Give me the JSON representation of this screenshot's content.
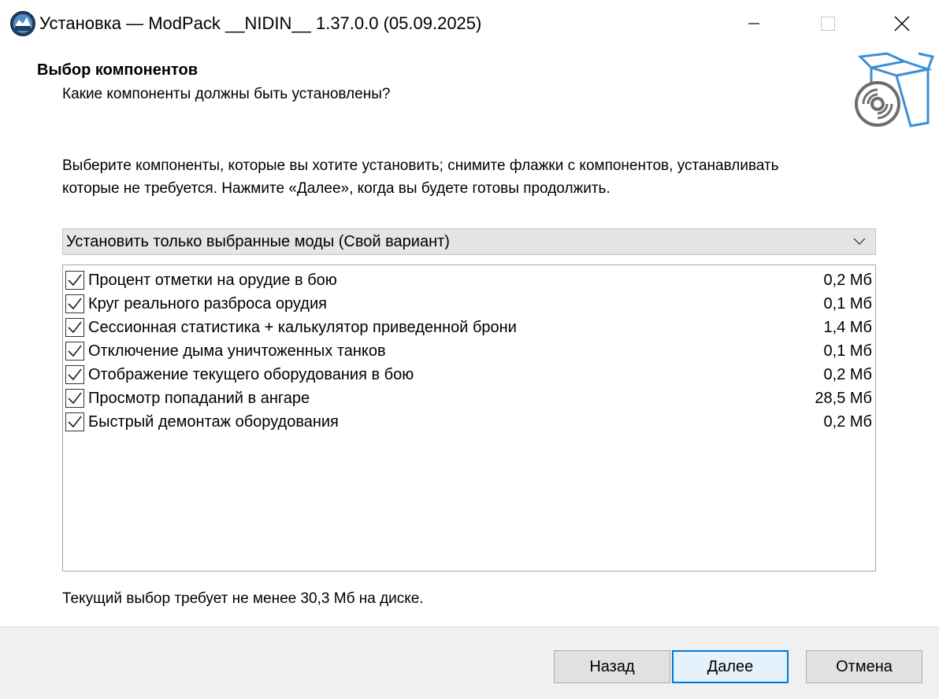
{
  "window": {
    "title": "Установка — ModPack __NIDIN__ 1.37.0.0 (05.09.2025)",
    "icon": "modpack-logo-icon"
  },
  "header": {
    "title": "Выбор компонентов",
    "subtitle": "Какие компоненты должны быть установлены?",
    "icon": "install-box-disc-icon"
  },
  "description": {
    "line1": "Выберите компоненты, которые вы хотите установить; снимите флажки с компонентов, устанавливать",
    "line2": "которые не требуется. Нажмите «Далее», когда вы будете готовы продолжить."
  },
  "combo": {
    "value": "Установить только выбранные моды (Свой вариант)"
  },
  "components": [
    {
      "label": "Процент отметки на орудие в бою",
      "size": "0,2 Мб",
      "checked": true
    },
    {
      "label": "Круг реального разброса орудия",
      "size": "0,1 Мб",
      "checked": true
    },
    {
      "label": "Сессионная статистика + калькулятор приведенной брони",
      "size": "1,4 Мб",
      "checked": true
    },
    {
      "label": "Отключение дыма уничтоженных танков",
      "size": "0,1 Мб",
      "checked": true
    },
    {
      "label": "Отображение текущего оборудования в бою",
      "size": "0,2 Мб",
      "checked": true
    },
    {
      "label": "Просмотр попаданий в ангаре",
      "size": "28,5 Мб",
      "checked": true
    },
    {
      "label": "Быстрый демонтаж оборудования",
      "size": "0,2 Мб",
      "checked": true
    }
  ],
  "footer": {
    "space_text": "Текущий выбор требует не менее 30,3 Мб на диске."
  },
  "buttons": {
    "back": "Назад",
    "next": "Далее",
    "cancel": "Отмена"
  },
  "colors": {
    "accent": "#0078d7",
    "icon_blue": "#3d8fd4",
    "icon_gray": "#6d6d6d"
  }
}
